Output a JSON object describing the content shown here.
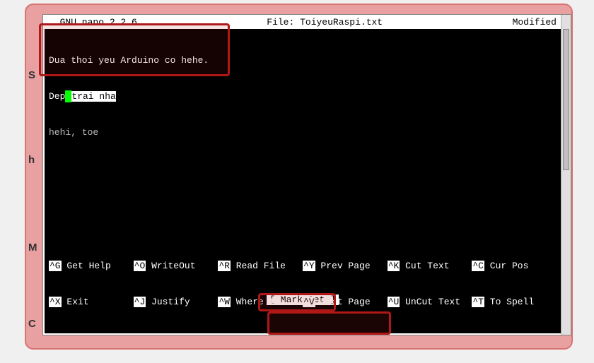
{
  "titleBar": {
    "appName": "  GNU nano 2.2.6",
    "fileLabel": "File: ToiyeuRaspi.txt",
    "status": "Modified"
  },
  "content": {
    "line1": "Dua thoi yeu Arduino co hehe.",
    "line2_prefix": "Dep",
    "line2_cursor": " ",
    "line2_selected": "trai nha",
    "line3": "hehi, toe"
  },
  "statusMessage": "[ Mark Set ]",
  "shortcuts": {
    "row1": [
      {
        "key": "^G",
        "label": " Get Help"
      },
      {
        "key": "^O",
        "label": " WriteOut"
      },
      {
        "key": "^R",
        "label": " Read File"
      },
      {
        "key": "^Y",
        "label": " Prev Page"
      },
      {
        "key": "^K",
        "label": " Cut Text"
      },
      {
        "key": "^C",
        "label": " Cur Pos"
      }
    ],
    "row2": [
      {
        "key": "^X",
        "label": " Exit"
      },
      {
        "key": "^J",
        "label": " Justify"
      },
      {
        "key": "^W",
        "label": " Where Is"
      },
      {
        "key": "^V",
        "label": " Next Page"
      },
      {
        "key": "^U",
        "label": " UnCut Text"
      },
      {
        "key": "^T",
        "label": " To Spell"
      }
    ]
  },
  "sideLetters": {
    "s": "S",
    "h": "h",
    "m": "M",
    "c": "C"
  }
}
